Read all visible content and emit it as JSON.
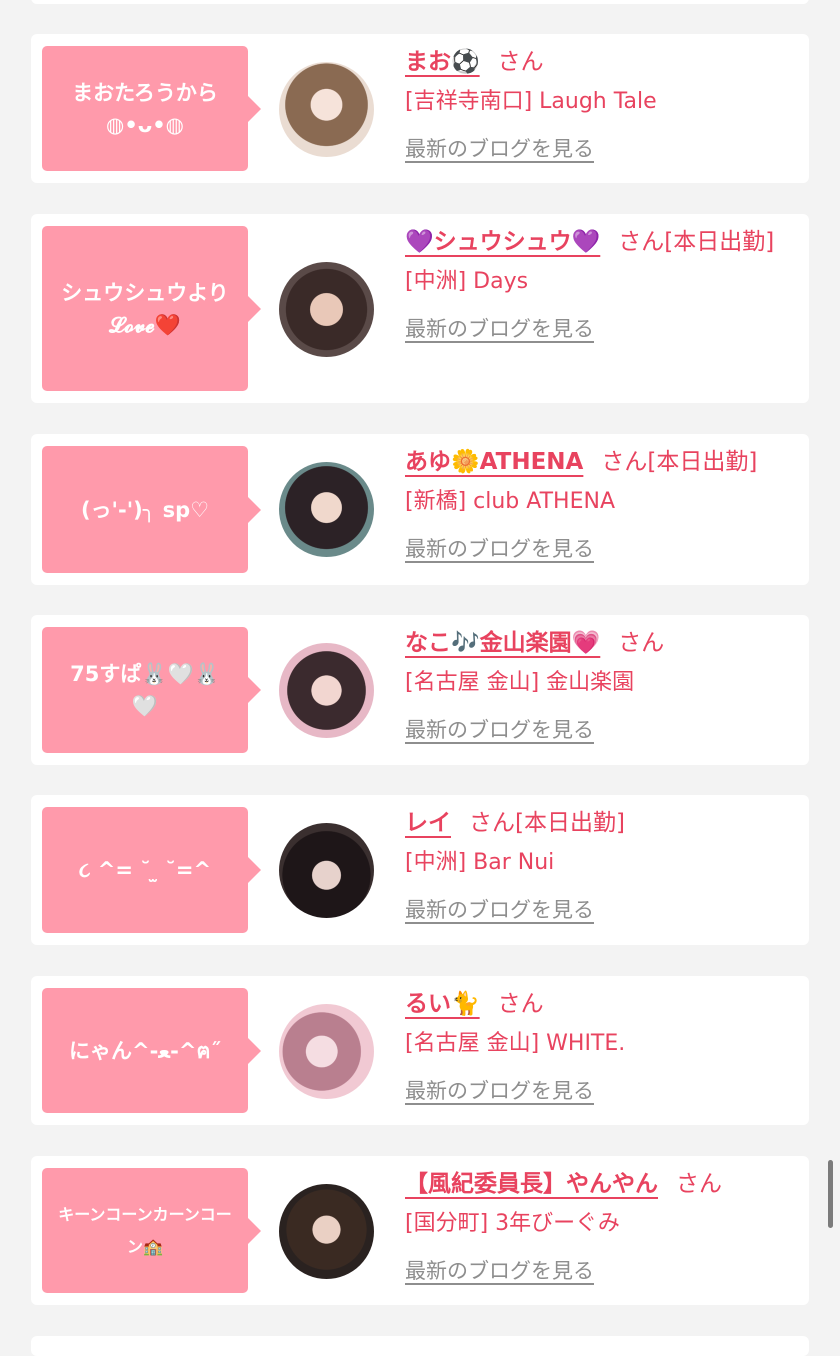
{
  "cards": [
    {
      "bubble": "まおたろうから\n◍•ᴗ•◍",
      "name": "まお⚽",
      "suffix": "さん",
      "shop": "[吉祥寺南口] Laugh Tale",
      "blog_link": "最新のブログを見る"
    },
    {
      "bubble": "シュウシュウより\n𝓛𝓸𝓿𝓮❤️",
      "name": "💜シュウシュウ💜",
      "suffix": "さん[本日出勤]",
      "shop": "[中洲] Days",
      "blog_link": "最新のブログを見る"
    },
    {
      "bubble": "(っ'-')╮ sp♡",
      "name": "あゆ🌼ATHENA",
      "suffix": "さん[本日出勤]",
      "shop": "[新橋] club ATHENA",
      "blog_link": "最新のブログを見る"
    },
    {
      "bubble": "75すぱ🐰🤍🐰\n🤍",
      "name": "なこ🎶金山楽園💗",
      "suffix": "さん",
      "shop": "[名古屋 金山] 金山楽園",
      "blog_link": "最新のブログを見る"
    },
    {
      "bubble": "૮ ^= ˘ ̫ ˘=^",
      "name": "レイ",
      "suffix": "さん[本日出勤]",
      "shop": "[中洲] Bar Nui",
      "blog_link": "最新のブログを見る"
    },
    {
      "bubble": "にゃん^-ﻌ-^ฅ˝",
      "name": "るい🐈",
      "suffix": "さん",
      "shop": "[名古屋 金山] WHITE.",
      "blog_link": "最新のブログを見る"
    },
    {
      "bubble": "キーンコーンカーンコーン🏫",
      "name": "【風紀委員長】やんやん",
      "suffix": "さん",
      "shop": "[国分町] 3年びーぐみ",
      "blog_link": "最新のブログを見る"
    }
  ]
}
